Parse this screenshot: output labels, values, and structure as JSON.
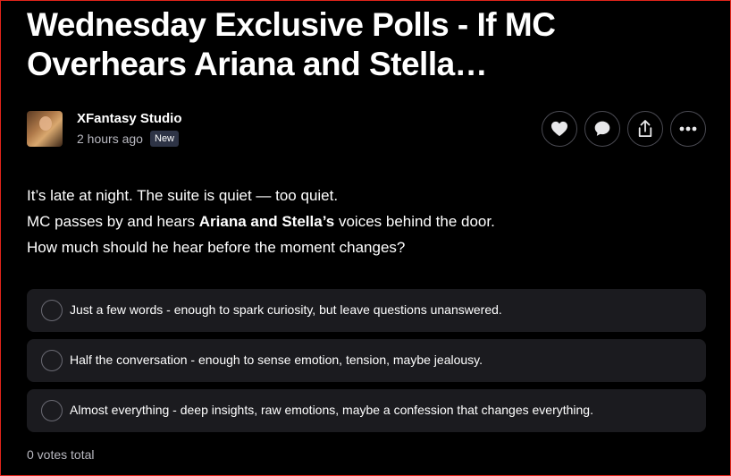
{
  "post": {
    "title": "Wednesday Exclusive Polls - If MC Overhears Ariana and Stella…",
    "author": "XFantasy Studio",
    "time": "2 hours ago",
    "badge": "New",
    "body": {
      "line1": "It’s late at night. The suite is quiet — too quiet.",
      "line2_prefix": "MC passes by and hears ",
      "line2_bold": "Ariana and Stella’s",
      "line2_suffix": " voices behind the door.",
      "line3": "How much should he hear before the moment changes?"
    }
  },
  "actions": [
    {
      "icon": "heart-icon"
    },
    {
      "icon": "comment-icon"
    },
    {
      "icon": "share-icon"
    },
    {
      "icon": "more-icon"
    }
  ],
  "poll": {
    "options": [
      {
        "label": "Just a few words - enough to spark curiosity, but leave questions unanswered."
      },
      {
        "label": "Half the conversation - enough to sense emotion, tension, maybe jealousy."
      },
      {
        "label": "Almost everything - deep insights, raw emotions, maybe a confession that changes everything."
      }
    ],
    "total": "0 votes total"
  },
  "colors": {
    "background": "#000000",
    "option_bg": "#1b1b1f",
    "badge_bg": "#2e3446",
    "muted_text": "#b8b8c0",
    "frame": "#e0241b"
  }
}
